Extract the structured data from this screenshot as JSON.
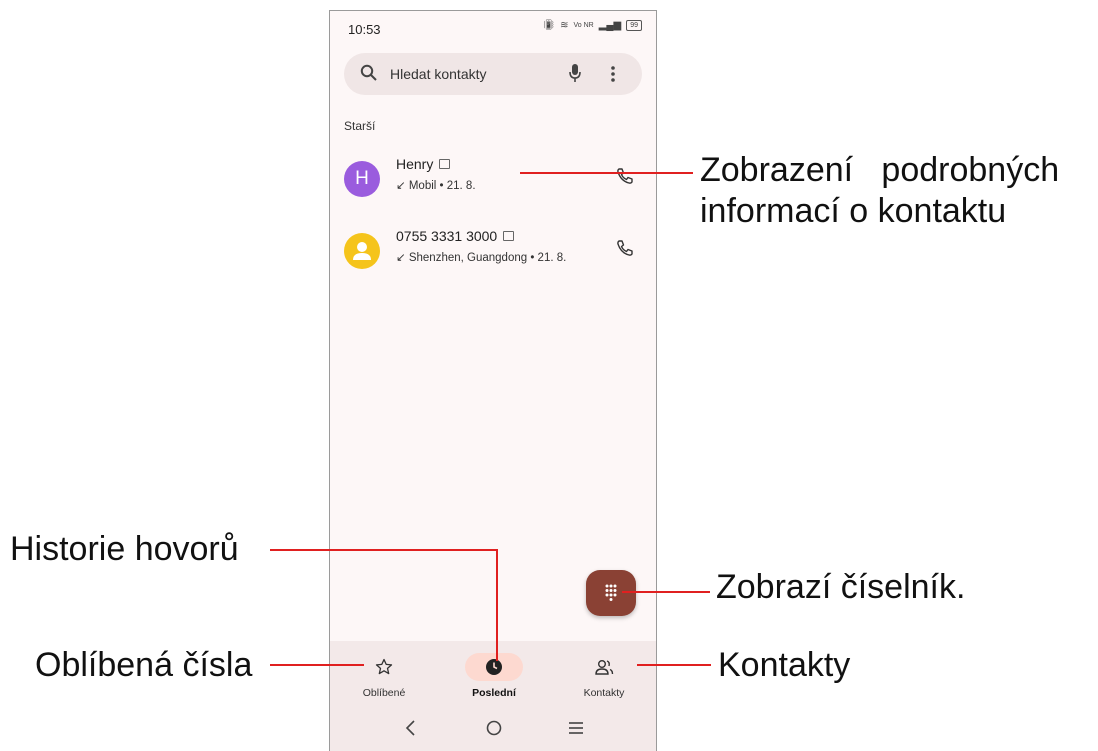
{
  "status_bar": {
    "time": "10:53",
    "network": "Vo NR",
    "battery": "99"
  },
  "search": {
    "placeholder": "Hledat kontakty",
    "icon": "search-icon",
    "mic_icon": "mic-icon",
    "more_icon": "more-vert-icon"
  },
  "section_label": "Starší",
  "calls": [
    {
      "avatar_letter": "H",
      "avatar_color": "#9a5cde",
      "name": "Henry",
      "direction_arrow": "↙",
      "detail": "Mobil • 21. 8."
    },
    {
      "avatar_letter": "",
      "avatar_color": "#f5c41b",
      "name": "0755 3331 3000",
      "direction_arrow": "↙",
      "detail": "Shenzhen, Guangdong • 21. 8."
    }
  ],
  "fab_icon": "dialpad-icon",
  "bottom_nav": [
    {
      "label": "Oblíbené",
      "icon": "star-icon",
      "active": false
    },
    {
      "label": "Poslední",
      "icon": "clock-icon",
      "active": true
    },
    {
      "label": "Kontakty",
      "icon": "people-icon",
      "active": false
    }
  ],
  "system_nav": [
    "back-icon",
    "home-icon",
    "recents-icon"
  ],
  "annotations": {
    "contact_details_line1": "Zobrazení   podrobných",
    "contact_details_line2": "informací o kontaktu",
    "call_history": "Historie hovorů",
    "dialpad": "Zobrazí číselník.",
    "favorites": "Oblíbená čísla",
    "contacts": "Kontakty"
  },
  "colors": {
    "accent": "#8a4134",
    "annotation_line": "#e02020",
    "active_pill": "#fdd9d0"
  }
}
